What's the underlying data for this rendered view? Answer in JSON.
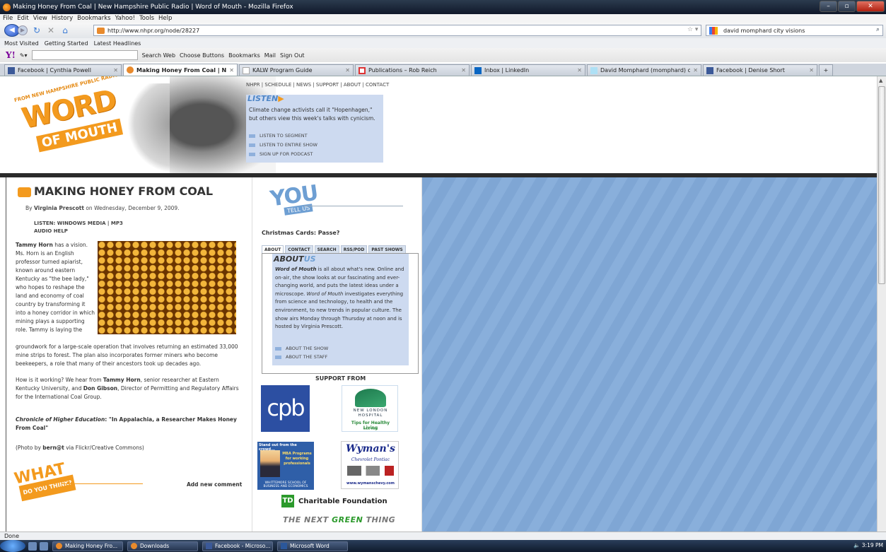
{
  "window": {
    "title": "Making Honey From Coal | New Hampshire Public Radio | Word of Mouth - Mozilla Firefox"
  },
  "menu": [
    "File",
    "Edit",
    "View",
    "History",
    "Bookmarks",
    "Yahoo!",
    "Tools",
    "Help"
  ],
  "nav": {
    "url": "http://www.nhpr.org/node/28227",
    "search_value": "david momphard city visions"
  },
  "bookmarks": [
    "Most Visited",
    "Getting Started",
    "Latest Headlines"
  ],
  "yahoo_toolbar": [
    "Search Web",
    "Choose Buttons",
    "Bookmarks",
    "Mail",
    "Sign Out"
  ],
  "tabs": [
    {
      "label": "Facebook | Cynthia Powell",
      "icon": "facebook-icon"
    },
    {
      "label": "Making Honey From Coal | New H...",
      "icon": "nhpr-icon"
    },
    {
      "label": "KALW Program Guide",
      "icon": "page-icon"
    },
    {
      "label": "Publications – Rob Reich",
      "icon": "publications-icon"
    },
    {
      "label": "Inbox | LinkedIn",
      "icon": "linkedin-icon"
    },
    {
      "label": "David Momphard (momphard) on ...",
      "icon": "twitter-icon"
    },
    {
      "label": "Facebook | Denise Short",
      "icon": "facebook-icon"
    }
  ],
  "header": {
    "from_line": "FROM NEW HAMPSHIRE PUBLIC RADIO",
    "logo_word": "WORD",
    "logo_mouth": "OF MOUTH",
    "topnav": "NHPR | SCHEDULE | NEWS | SUPPORT | ABOUT | CONTACT",
    "listen_title": "LISTEN",
    "listen_arrow": "▶",
    "listen_desc": "Climate change activists call it \"Hopenhagen,\" but others view this week's talks with cynicism.",
    "listen_links": [
      "LISTEN TO SEGMENT",
      "LISTEN TO ENTIRE SHOW",
      "SIGN UP FOR PODCAST"
    ]
  },
  "article": {
    "title": "MAKING HONEY FROM COAL",
    "byline_prefix": "By ",
    "author": "Virginia Prescott",
    "byline_suffix": " on Wednesday, December 9, 2009.",
    "listen_line": "LISTEN: WINDOWS MEDIA | MP3",
    "audio_help": "AUDIO HELP",
    "lead_name": "Tammy Horn",
    "lead_text": " has a vision. Ms. Horn is an English professor turned apiarist, known around eastern Kentucky as \"the bee lady,\" who hopes to reshape the land and economy of coal country by transforming it into a honey corridor in which mining plays a supporting role. Tammy is laying the",
    "cont_text": "groundwork for a large-scale operation that involves returning an estimated 33,000 mine strips to forest. The plan also incorporates former miners who become beekeepers, a role that many of their ancestors took up decades ago.",
    "p2_a": "How is it working? We hear from ",
    "p2_b": "Tammy Horn",
    "p2_c": ", senior researcher at Eastern Kentucky University, and ",
    "p2_d": "Don Gibson",
    "p2_e": ", Director of Permitting and Regulatory Affairs for the International Coal Group.",
    "p3_a": "Chronicle of Higher Education",
    "p3_b": ": \"In Appalachia, a Researcher Makes Honey From Coal\"",
    "p4_a": "(Photo by ",
    "p4_b": "bern@t",
    "p4_c": " via Flickr/Creative Commons)",
    "what": "WHAT",
    "do_you_think": "DO YOU THINK?",
    "add_comment": "Add new comment"
  },
  "sidebar": {
    "you": "YOU",
    "tell_us": "TELL US",
    "question": "Christmas Cards: Passe?",
    "tabs": [
      "ABOUT",
      "CONTACT",
      "SEARCH",
      "RSS/POD",
      "PAST SHOWS"
    ],
    "about_title_a": "ABOUT",
    "about_title_b": "US",
    "about_lead": "Word of Mouth",
    "about_text_a": " is all about what's new. Online and on-air, the show looks at our fascinating and ever-changing world, and puts the latest ideas under a microscope. ",
    "about_italic": "Word of Mouth",
    "about_text_b": " investigates everything from science and technology, to health and the environment, to new trends in popular culture. The show airs Monday through Thursday at noon and is hosted by Virginia Prescott.",
    "about_links": [
      "ABOUT THE SHOW",
      "ABOUT THE STAFF"
    ],
    "support_from": "SUPPORT FROM",
    "cpb": "cpb",
    "nlh_name": "NEW LONDON HOSPITAL",
    "nlh_tag": "Tips for Healthy Living",
    "nlh_click": "Click Here",
    "wsb_head": "Stand out from the crowd...",
    "wsb_mba": "MBA Programs for working professionals",
    "wsb_school": "WHITTEMORE SCHOOL OF BUSINESS AND ECONOMICS",
    "wyman_name": "Wyman's",
    "wyman_sub": "Chevrolet Pontiac",
    "wyman_url": "www.wymanschevy.com",
    "td_logo": "TD",
    "td_name": "Charitable Foundation",
    "next_a": "THE NEXT ",
    "next_b": "GREEN",
    "next_c": " THING"
  },
  "status": {
    "text": "Done"
  },
  "taskbar": {
    "items": [
      "Making Honey Fro...",
      "Downloads",
      "Facebook - Microso...",
      "Microsoft Word"
    ],
    "clock": "3:19 PM"
  }
}
